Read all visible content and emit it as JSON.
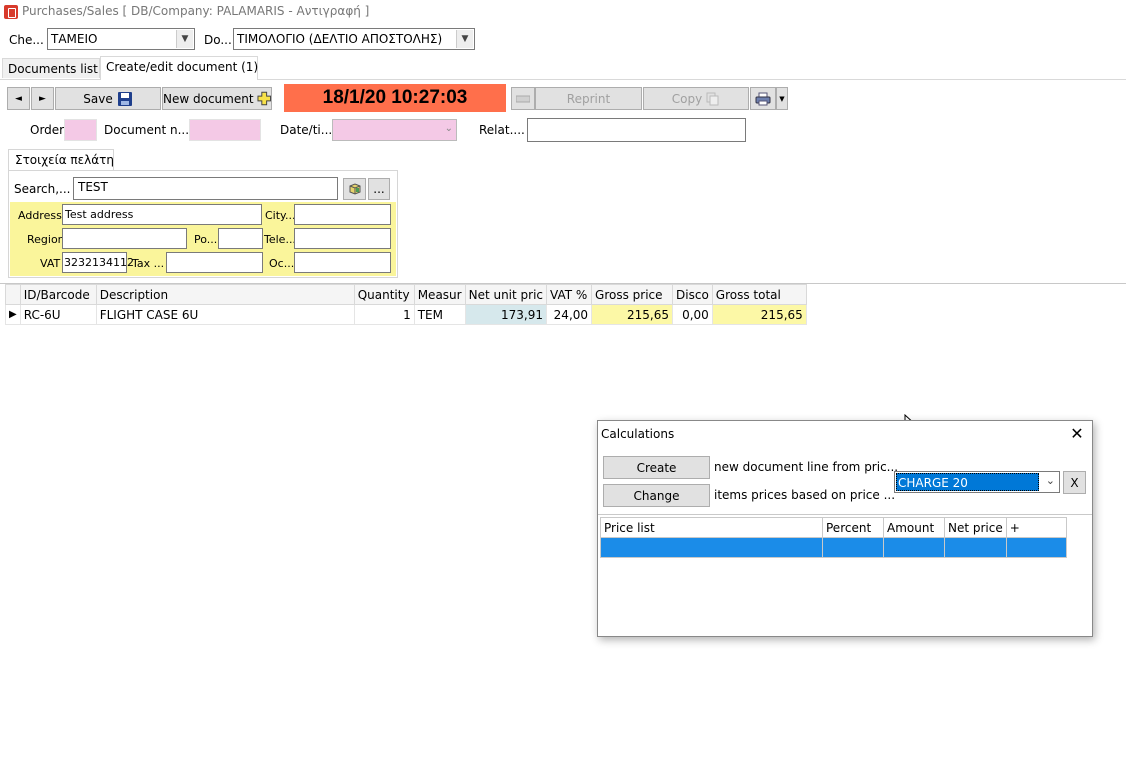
{
  "window": {
    "title": "Purchases/Sales  [ DB/Company: PALAMARIS - Αντιγραφή ]"
  },
  "top_filters": {
    "cash_label": "Che...",
    "cash_value": "ΤΑΜΕΙΟ",
    "doc_label": "Do...",
    "doc_value": "ΤΙΜΟΛΟΓΙΟ (ΔΕΛΤΙΟ ΑΠΟΣΤΟΛΗΣ)"
  },
  "tabs": [
    {
      "label": "Documents list"
    },
    {
      "label": "Create/edit document (1)"
    }
  ],
  "toolbar": {
    "prev_label": "◄",
    "next_label": "►",
    "save_label": "Save",
    "new_label": "New document",
    "datetime": "18/1/20 10:27:03",
    "reprint_label": "Reprint",
    "copy_label": "Copy",
    "datetime_color": "#ff6f4b"
  },
  "doc_fields": {
    "order_label": "Order",
    "docnum_label": "Document n...",
    "date_label": "Date/ti...",
    "relat_label": "Relat...."
  },
  "customer": {
    "tab_label": "Στοιχεία πελάτη",
    "search_label": "Search,...",
    "search_value": "TEST",
    "more_label": "...",
    "address_label": "Address",
    "address_value": "Test address",
    "city_label": "City...",
    "region_label": "Region",
    "po_label": "Po...",
    "tele_label": "Tele...",
    "vat_label": "VAT",
    "vat_value": "3232134112",
    "tax_label": "Tax ...",
    "oc_label": "Oc..."
  },
  "lines_table": {
    "columns": [
      "ID/Barcode",
      "Description",
      "Quantity",
      "Measur",
      "Net unit pric",
      "VAT %",
      "Gross price",
      "Disco",
      "Gross total"
    ],
    "rows": [
      [
        "RC-6U",
        "FLIGHT CASE 6U",
        "1",
        "TEM",
        "173,91",
        "24,00",
        "215,65",
        "0,00",
        "215,65"
      ]
    ]
  },
  "calculations_dialog": {
    "title": "Calculations",
    "create_label": "Create",
    "create_desc": "new document line from pric...",
    "change_label": "Change",
    "change_desc": "items prices based on price ...",
    "charge_value": "CHARGE 20",
    "x_label": "X",
    "columns": [
      "Price list",
      "Percent",
      "Amount",
      "Net price",
      "+"
    ],
    "selection_color": "#1b8ce8"
  }
}
